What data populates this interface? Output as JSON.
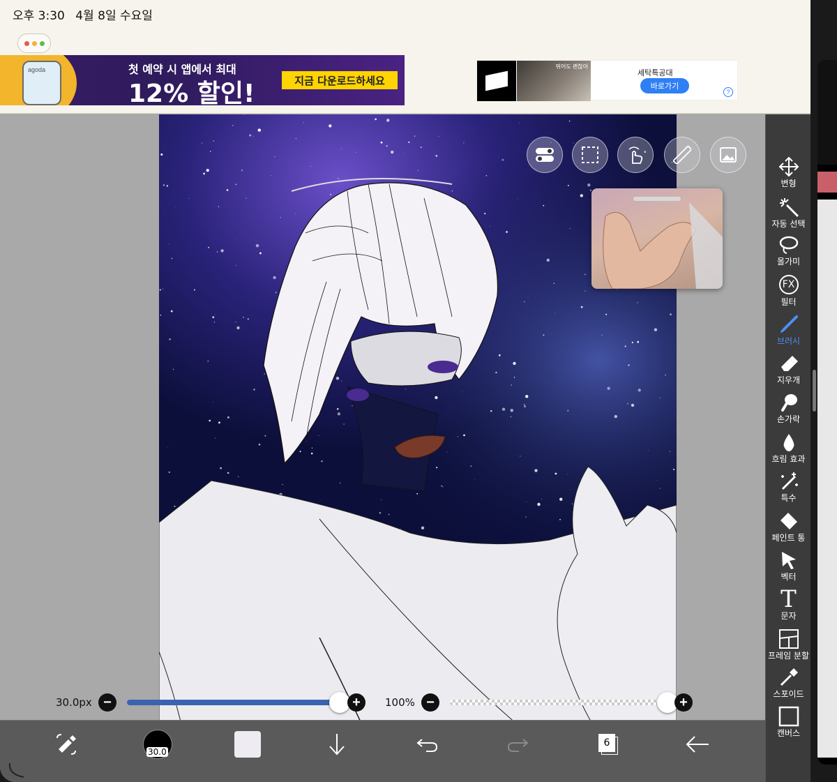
{
  "status": {
    "time": "오후 3:30",
    "date": "4월 8일 수요일"
  },
  "ads": {
    "left": {
      "brand": "agoda",
      "line1": "첫 예약 시 앱에서 최대",
      "line2": "12% 할인!",
      "cta": "지금 다운로드하세요"
    },
    "right": {
      "thumb_text": "뛰어도 괜찮아",
      "title": "세탁특공대",
      "button": "바로가기",
      "help": "?"
    }
  },
  "canvas_tools": [
    "toggle-icon",
    "selection-icon",
    "gesture-icon",
    "ruler-icon",
    "reference-image-icon"
  ],
  "tools": [
    {
      "id": "transform",
      "label": "변형",
      "icon": "move-icon"
    },
    {
      "id": "auto-select",
      "label": "자동 선택",
      "icon": "magic-wand-icon"
    },
    {
      "id": "lasso",
      "label": "올가미",
      "icon": "lasso-icon"
    },
    {
      "id": "filter",
      "label": "필터",
      "icon": "fx-icon",
      "glyph": "FX"
    },
    {
      "id": "brush",
      "label": "브러시",
      "icon": "brush-icon",
      "active": true
    },
    {
      "id": "eraser",
      "label": "지우개",
      "icon": "eraser-icon"
    },
    {
      "id": "finger",
      "label": "손가락",
      "icon": "finger-icon"
    },
    {
      "id": "blur",
      "label": "흐림 효과",
      "icon": "drop-icon"
    },
    {
      "id": "special",
      "label": "특수",
      "icon": "sparkle-icon"
    },
    {
      "id": "paint-bucket",
      "label": "페인트 통",
      "icon": "bucket-icon"
    },
    {
      "id": "vector",
      "label": "벡터",
      "icon": "cursor-icon"
    },
    {
      "id": "text",
      "label": "문자",
      "icon": "text-icon",
      "glyph": "T"
    },
    {
      "id": "frame-split",
      "label": "프레임 분할",
      "icon": "frame-icon"
    },
    {
      "id": "eyedropper",
      "label": "스포이드",
      "icon": "eyedropper-icon"
    },
    {
      "id": "canvas",
      "label": "캔버스",
      "icon": "canvas-icon"
    }
  ],
  "brush_size": {
    "label": "30.0px",
    "value": 30.0,
    "fraction": 0.99
  },
  "opacity": {
    "label": "100%",
    "value": 100,
    "fraction": 1.0
  },
  "bottom": {
    "brush_size_badge": "30.0",
    "layer_count": "6"
  },
  "colors": {
    "accent": "#4f8ff7",
    "slider": "#3a64b0",
    "lips": "#7a3a2a",
    "toolbar": "#3b3b3b"
  }
}
